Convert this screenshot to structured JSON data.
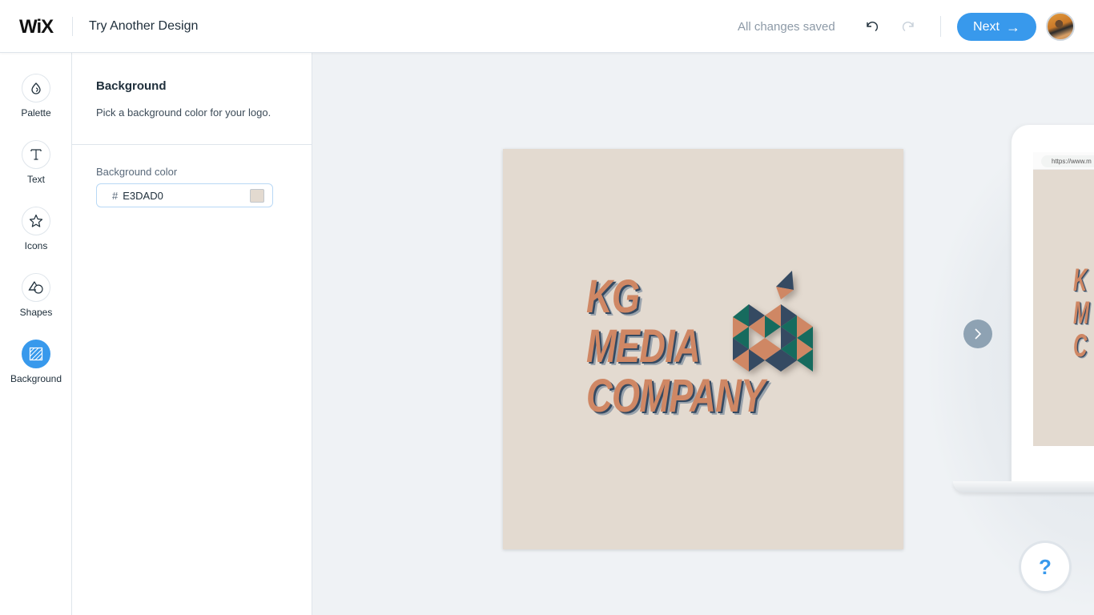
{
  "header": {
    "brand": "WiX",
    "title": "Try Another Design",
    "save_status": "All changes saved",
    "next_label": "Next",
    "next_arrow": "→"
  },
  "sidebar": {
    "items": [
      {
        "label": "Palette",
        "icon": "droplet-icon",
        "active": false
      },
      {
        "label": "Text",
        "icon": "text-t-icon",
        "active": false
      },
      {
        "label": "Icons",
        "icon": "star-icon",
        "active": false
      },
      {
        "label": "Shapes",
        "icon": "shapes-icon",
        "active": false
      },
      {
        "label": "Background",
        "icon": "background-hatch-icon",
        "active": true
      }
    ]
  },
  "panel": {
    "title": "Background",
    "description": "Pick a background color for your logo.",
    "field_label": "Background color",
    "hash": "#",
    "color_value": "E3DAD0"
  },
  "colors": {
    "accent": "#3899EC",
    "logo_background": "#E3DAD0",
    "logo_orange": "#CF8764",
    "logo_navy": "#354A62",
    "logo_teal": "#166B5E"
  },
  "canvas": {
    "logo_lines": [
      "KG",
      "MEDIA",
      "COMPANY"
    ],
    "mockup_url": "https://www.m",
    "mini_logo_lines": [
      "K",
      "M",
      "C"
    ],
    "help_label": "?"
  }
}
